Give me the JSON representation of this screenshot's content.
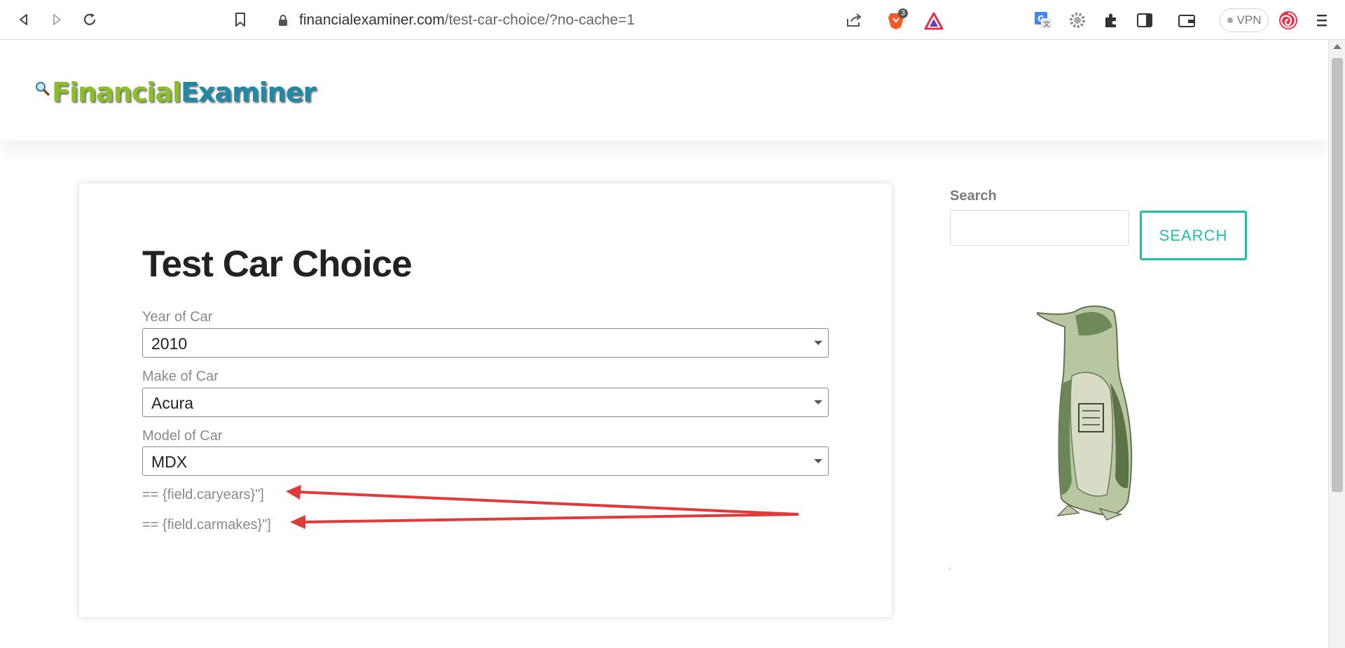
{
  "browser": {
    "url_domain": "financialexaminer.com",
    "url_path": "/test-car-choice/?no-cache=1",
    "brave_badge": "3",
    "vpn_label": "VPN"
  },
  "site": {
    "logo_part1": "Financial",
    "logo_part2": "Examiner"
  },
  "article": {
    "title": "Test Car Choice",
    "fields": [
      {
        "label": "Year of Car",
        "value": "2010"
      },
      {
        "label": "Make of Car",
        "value": "Acura"
      },
      {
        "label": "Model of Car",
        "value": "MDX"
      }
    ],
    "shortcode_lines": [
      "== {field.caryears}\"]",
      "== {field.carmakes}\"]"
    ]
  },
  "sidebar": {
    "search_label": "Search",
    "search_value": "",
    "search_button": "SEARCH"
  },
  "colors": {
    "accent": "#1fbfad",
    "annotation_arrow": "#e03a3a",
    "logo_green": "#8bbf2a",
    "logo_blue": "#1f8aa8"
  }
}
